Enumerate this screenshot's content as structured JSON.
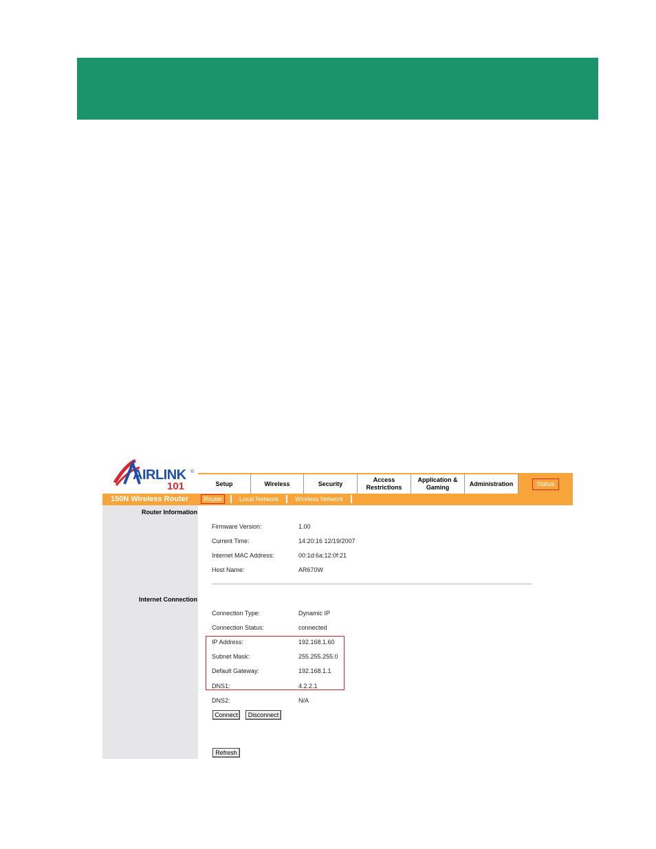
{
  "logo": {
    "text": "AIRLINK",
    "number": "101",
    "mark": "®"
  },
  "tabs": [
    {
      "label": "Setup"
    },
    {
      "label": "Wireless"
    },
    {
      "label": "Security"
    },
    {
      "label": "Access\nRestrictions"
    },
    {
      "label": "Application &\nGaming"
    },
    {
      "label": "Administration"
    },
    {
      "label": "Status"
    }
  ],
  "product_name": "150N Wireless Router",
  "subnav": [
    {
      "label": "Router",
      "active": true
    },
    {
      "label": "Local Network"
    },
    {
      "label": "Wireless Network"
    }
  ],
  "sections": {
    "router_info": "Router Information",
    "internet_connection": "Internet Connection"
  },
  "router_info": [
    {
      "label": "Firmware Version:",
      "value": "1.00"
    },
    {
      "label": "Current Time:",
      "value": "14:20:16 12/19/2007"
    },
    {
      "label": "Internet MAC Address:",
      "value": "00:1d:6a:12:0f:21"
    },
    {
      "label": "Host Name:",
      "value": "AR670W"
    }
  ],
  "internet_info": [
    {
      "label": "Connection Type:",
      "value": "Dynamic IP"
    },
    {
      "label": "Connection Status:",
      "value": "connected"
    },
    {
      "label": "IP Address:",
      "value": "192.168.1.60"
    },
    {
      "label": "Subnet Mask:",
      "value": "255.255.255.0"
    },
    {
      "label": "Default Gateway:",
      "value": "192.168.1.1"
    },
    {
      "label": "DNS1:",
      "value": "4.2.2.1"
    },
    {
      "label": "DNS2:",
      "value": "N/A"
    }
  ],
  "buttons": {
    "connect": "Connect",
    "disconnect": "Disconnect",
    "refresh": "Refresh"
  },
  "colors": {
    "banner": "#1b946b",
    "accent": "#f7a53a",
    "highlight": "#d0242e"
  }
}
